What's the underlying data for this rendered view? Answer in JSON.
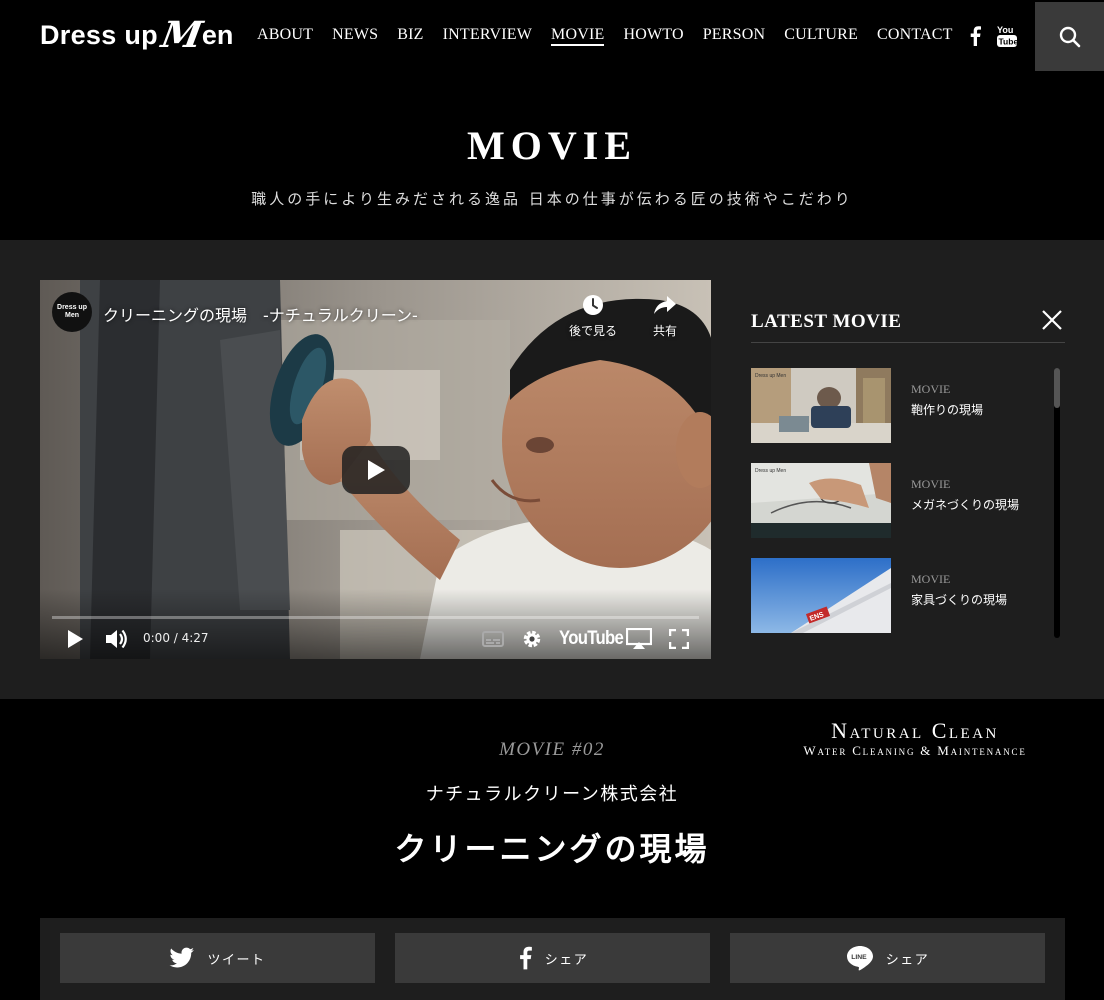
{
  "header": {
    "logo": {
      "part1": "Dress up",
      "part2": "M",
      "part3": "en"
    },
    "nav": [
      {
        "label": "ABOUT",
        "active": false
      },
      {
        "label": "NEWS",
        "active": false
      },
      {
        "label": "BIZ",
        "active": false
      },
      {
        "label": "INTERVIEW",
        "active": false
      },
      {
        "label": "MOVIE",
        "active": true
      },
      {
        "label": "HOWTO",
        "active": false
      },
      {
        "label": "PERSON",
        "active": false
      },
      {
        "label": "CULTURE",
        "active": false
      },
      {
        "label": "CONTACT",
        "active": false
      }
    ],
    "social": [
      "facebook-icon",
      "youtube-icon"
    ],
    "search_icon": "search-icon"
  },
  "hero": {
    "title": "MOVIE",
    "subtitle": "職人の手により生みだされる逸品 日本の仕事が伝わる匠の技術やこだわり"
  },
  "player": {
    "channel": "Dress up Men",
    "title": "クリーニングの現場　-ナチュラルクリーン-",
    "watch_later": "後で見る",
    "share": "共有",
    "time": "0:00 / 4:27",
    "progress": 0,
    "brand": "YouTube"
  },
  "latest": {
    "title": "LATEST MOVIE",
    "items": [
      {
        "category": "MOVIE",
        "name": "鞄作りの現場"
      },
      {
        "category": "MOVIE",
        "name": "メガネづくりの現場"
      },
      {
        "category": "MOVIE",
        "name": "家具づくりの現場"
      }
    ]
  },
  "info": {
    "brand_big": "Natural Clean",
    "brand_small": "Water Cleaning & Maintenance",
    "movie_number": "MOVIE #02",
    "company": "ナチュラルクリーン株式会社",
    "title": "クリーニングの現場"
  },
  "share": [
    {
      "icon": "twitter-icon",
      "label": "ツイート"
    },
    {
      "icon": "facebook-icon",
      "label": "シェア"
    },
    {
      "icon": "line-icon",
      "label": "シェア"
    }
  ],
  "colors": {
    "background": "#000000",
    "band": "#1e1e1e",
    "button": "#3a3a3a",
    "muted": "#999999"
  }
}
